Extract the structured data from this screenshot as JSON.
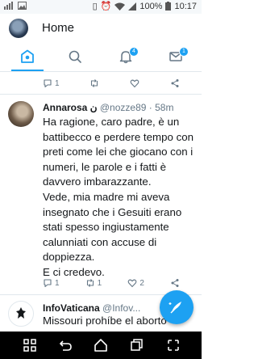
{
  "status_bar": {
    "battery": "100%",
    "time": "10:17",
    "icons": [
      "signal-bars-icon",
      "photo-icon",
      "wifi-icon",
      "battery-icon"
    ]
  },
  "header": {
    "title": "Home"
  },
  "tabs": [
    {
      "name": "home",
      "icon": "home-icon",
      "active": true
    },
    {
      "name": "search",
      "icon": "search-icon",
      "active": false
    },
    {
      "name": "notifications",
      "icon": "bell-icon",
      "badge": "4"
    },
    {
      "name": "messages",
      "icon": "mail-icon",
      "badge": "1"
    }
  ],
  "tweets": [
    {
      "reply_count": "1",
      "retweet_count": "",
      "like_count": ""
    },
    {
      "name": "Annarosa",
      "name_suffix": "ن",
      "handle": "@nozze89",
      "time": "· 58m",
      "paragraphs": [
        "Ha ragione, caro padre,  è un battibecco e perdere tempo con preti come lei che giocano con i numeri, le parole e i fatti è davvero imbarazzante.",
        "Vede, mia madre mi aveva insegnato che i Gesuiti erano stati spesso ingiustamente calunniati con accuse di doppiezza.",
        "E ci credevo."
      ],
      "reply_count": "1",
      "retweet_count": "1",
      "like_count": "2"
    },
    {
      "name": "InfoVaticana",
      "handle": "@Infov...",
      "text": "Missouri prohíbe el aborto"
    }
  ],
  "colors": {
    "accent": "#1da1f2",
    "secondary_text": "#657786",
    "divider": "#e1e8ed"
  }
}
